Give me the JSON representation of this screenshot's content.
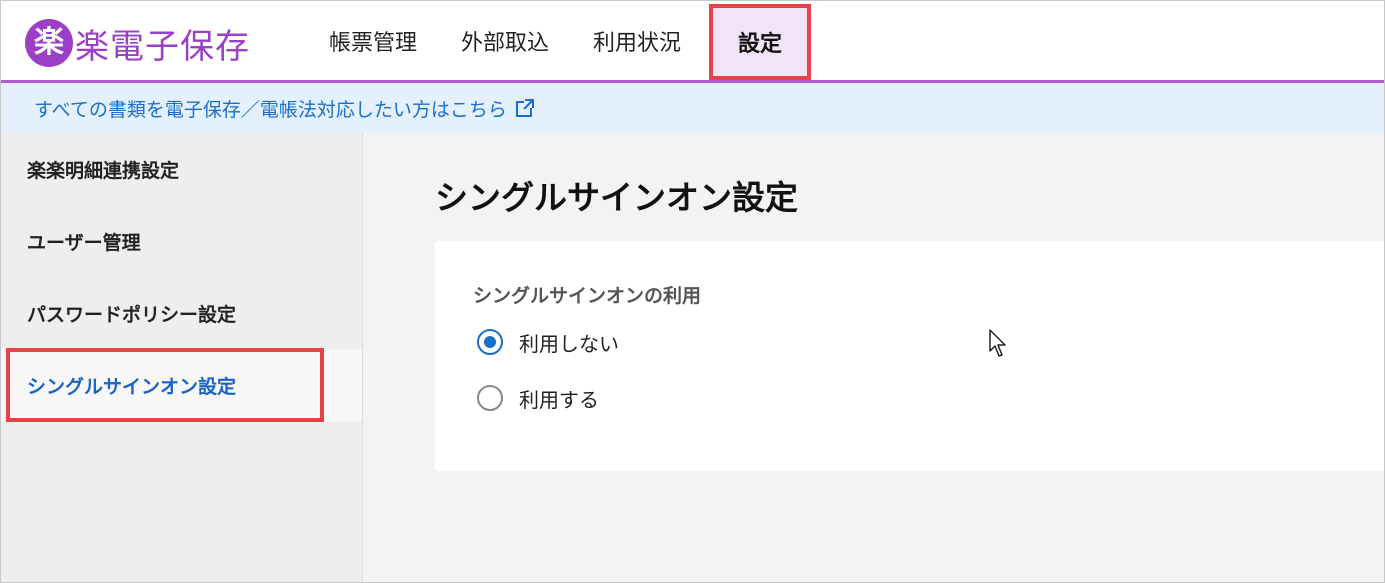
{
  "header": {
    "logo_mark": "楽",
    "logo_text": "楽電子保存",
    "nav": [
      {
        "label": "帳票管理"
      },
      {
        "label": "外部取込"
      },
      {
        "label": "利用状況"
      },
      {
        "label": "設定"
      }
    ]
  },
  "banner": {
    "link_text": "すべての書類を電子保存／電帳法対応したい方はこちら",
    "icon": "external-link-icon"
  },
  "sidebar": {
    "items": [
      {
        "label": "楽楽明細連携設定"
      },
      {
        "label": "ユーザー管理"
      },
      {
        "label": "パスワードポリシー設定"
      },
      {
        "label": "シングルサインオン設定"
      }
    ]
  },
  "main": {
    "title": "シングルサインオン設定",
    "field_label": "シングルサインオンの利用",
    "options": [
      {
        "label": "利用しない",
        "checked": true
      },
      {
        "label": "利用する",
        "checked": false
      }
    ]
  },
  "colors": {
    "brand": "#9b3fc7",
    "accent": "#1a6fcb",
    "highlight": "#e8414a"
  }
}
